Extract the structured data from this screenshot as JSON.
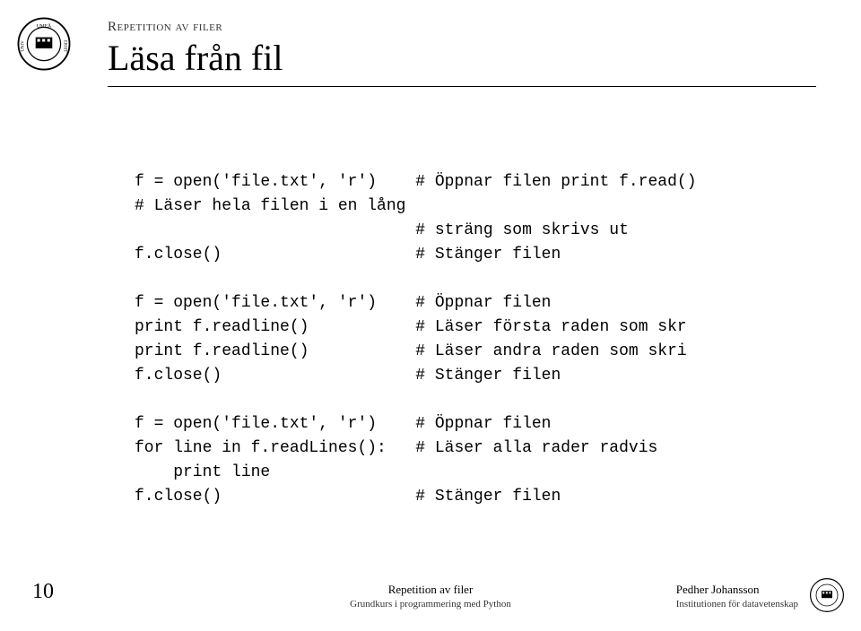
{
  "header": {
    "section_label": "Repetition av filer",
    "title": "Läsa från fil"
  },
  "code": "f = open('file.txt', 'r')    # Öppnar filen print f.read()\n# Läser hela filen i en lång\n                             # sträng som skrivs ut\nf.close()                    # Stänger filen\n\nf = open('file.txt', 'r')    # Öppnar filen\nprint f.readline()           # Läser första raden som skr\nprint f.readline()           # Läser andra raden som skri\nf.close()                    # Stänger filen\n\nf = open('file.txt', 'r')    # Öppnar filen\nfor line in f.readLines():   # Läser alla rader radvis\n    print line\nf.close()                    # Stänger filen",
  "page_number": "10",
  "footer": {
    "center_top": "Repetition av filer",
    "center_bottom": "Grundkurs i programmering med Python",
    "right_top": "Pedher Johansson",
    "right_bottom": "Institutionen för datavetenskap"
  }
}
